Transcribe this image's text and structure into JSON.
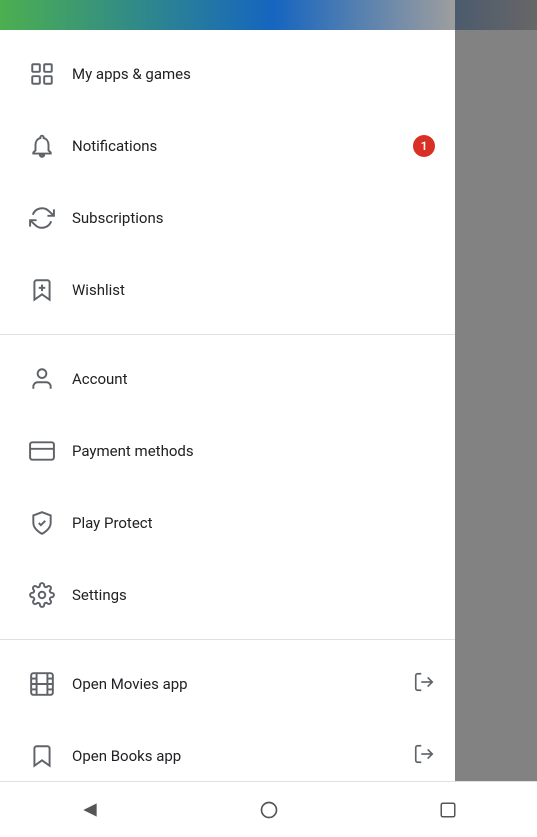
{
  "header": {
    "gradient_colors": [
      "#4caf50",
      "#1565c0",
      "#9e9e9e"
    ]
  },
  "menu": {
    "section1": [
      {
        "id": "my-apps-games",
        "label": "My apps & games",
        "icon": "grid-icon",
        "badge": null,
        "external": false
      },
      {
        "id": "notifications",
        "label": "Notifications",
        "icon": "bell-icon",
        "badge": "1",
        "external": false
      },
      {
        "id": "subscriptions",
        "label": "Subscriptions",
        "icon": "refresh-icon",
        "badge": null,
        "external": false
      },
      {
        "id": "wishlist",
        "label": "Wishlist",
        "icon": "bookmark-add-icon",
        "badge": null,
        "external": false
      }
    ],
    "section2": [
      {
        "id": "account",
        "label": "Account",
        "icon": "person-icon",
        "badge": null,
        "external": false
      },
      {
        "id": "payment-methods",
        "label": "Payment methods",
        "icon": "credit-card-icon",
        "badge": null,
        "external": false
      },
      {
        "id": "play-protect",
        "label": "Play Protect",
        "icon": "shield-icon",
        "badge": null,
        "external": false
      },
      {
        "id": "settings",
        "label": "Settings",
        "icon": "gear-icon",
        "badge": null,
        "external": false
      }
    ],
    "section3": [
      {
        "id": "open-movies-app",
        "label": "Open Movies app",
        "icon": "film-icon",
        "badge": null,
        "external": true
      },
      {
        "id": "open-books-app",
        "label": "Open Books app",
        "icon": "book-icon",
        "badge": null,
        "external": true
      }
    ]
  },
  "bottom_nav": {
    "back_label": "back",
    "home_label": "home",
    "recents_label": "recents"
  },
  "badge_colors": {
    "notification": "#d93025"
  }
}
